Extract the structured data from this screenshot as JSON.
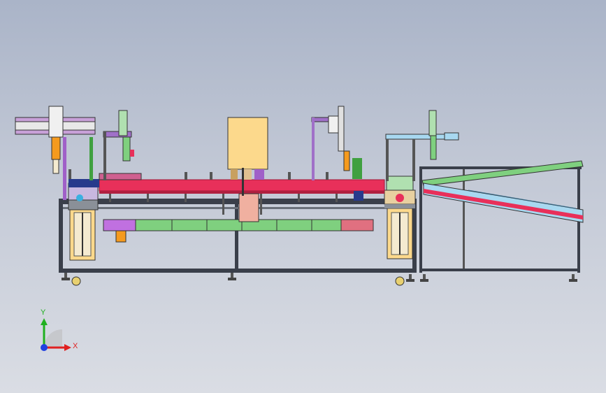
{
  "viewport": {
    "background_top": "#aab4c8",
    "background_bottom": "#dadde4"
  },
  "model": {
    "view": "front",
    "colors": {
      "frame": "#3a3f4a",
      "frame_light": "#8a9098",
      "conveyor_red": "#e8305a",
      "slide_green": "#7fd07f",
      "cabinet_yellow": "#fcd98c",
      "chute_blue": "#a8d8f0",
      "purple": "#a070c8",
      "orange": "#f59a1e",
      "navy": "#283a8c"
    }
  },
  "triad": {
    "x_label": "X",
    "y_label": "Y",
    "x_color": "#e02020",
    "y_color": "#20b020",
    "z_color": "#2040e0"
  }
}
